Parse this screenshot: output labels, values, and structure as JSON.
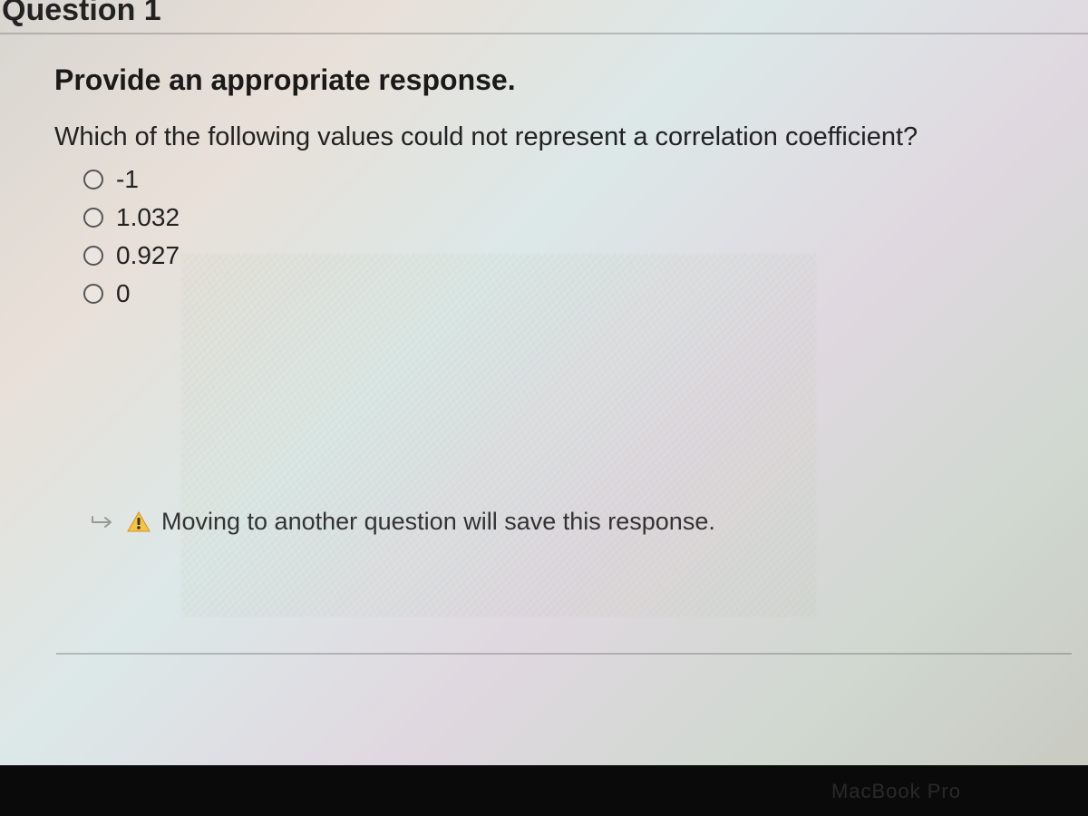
{
  "header": {
    "title": "Question 1"
  },
  "prompt": {
    "heading": "Provide an appropriate response.",
    "text": "Which of the following values could not represent a correlation coefficient?"
  },
  "options": [
    {
      "label": "-1"
    },
    {
      "label": "1.032"
    },
    {
      "label": "0.927"
    },
    {
      "label": "0"
    }
  ],
  "warning": {
    "text": "Moving to another question will save this response."
  },
  "device": {
    "label": "MacBook Pro"
  }
}
